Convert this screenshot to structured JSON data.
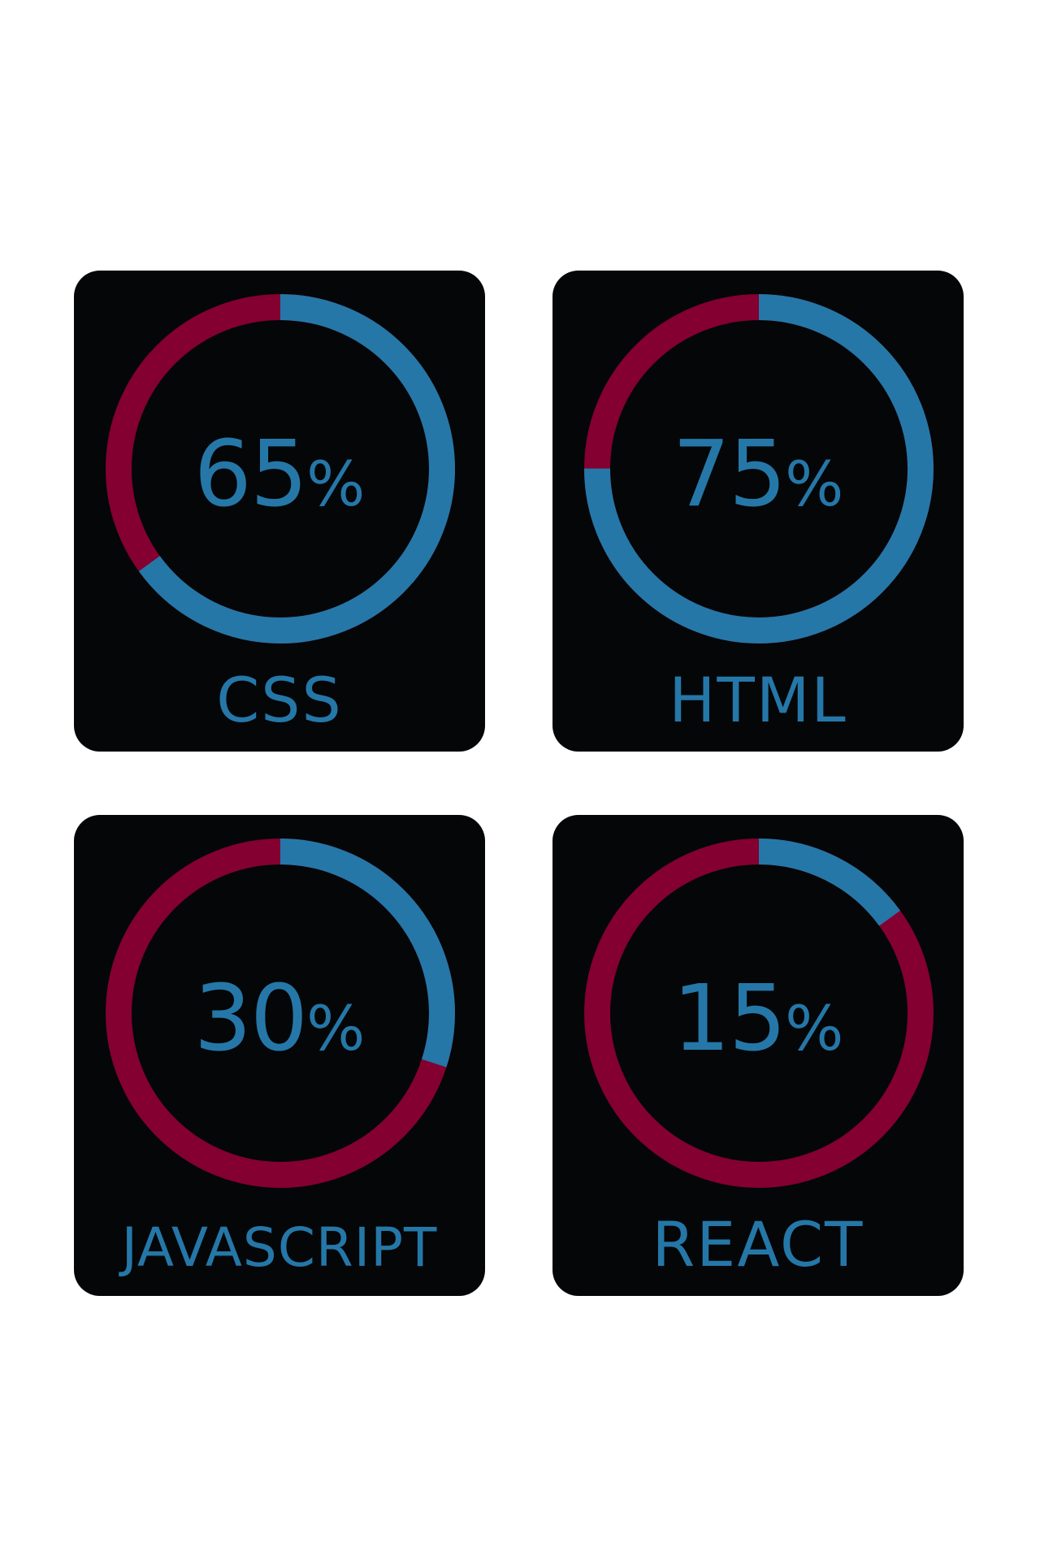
{
  "colors": {
    "accent": "#2577a8",
    "remainder": "#830030",
    "card": "#040608",
    "background": "#ffffff"
  },
  "chart_data": {
    "type": "pie",
    "percent_suffix": "%",
    "skills": [
      {
        "label": "CSS",
        "value": 65
      },
      {
        "label": "HTML",
        "value": 75
      },
      {
        "label": "JAVASCRIPT",
        "value": 30
      },
      {
        "label": "REACT",
        "value": 15
      }
    ]
  }
}
